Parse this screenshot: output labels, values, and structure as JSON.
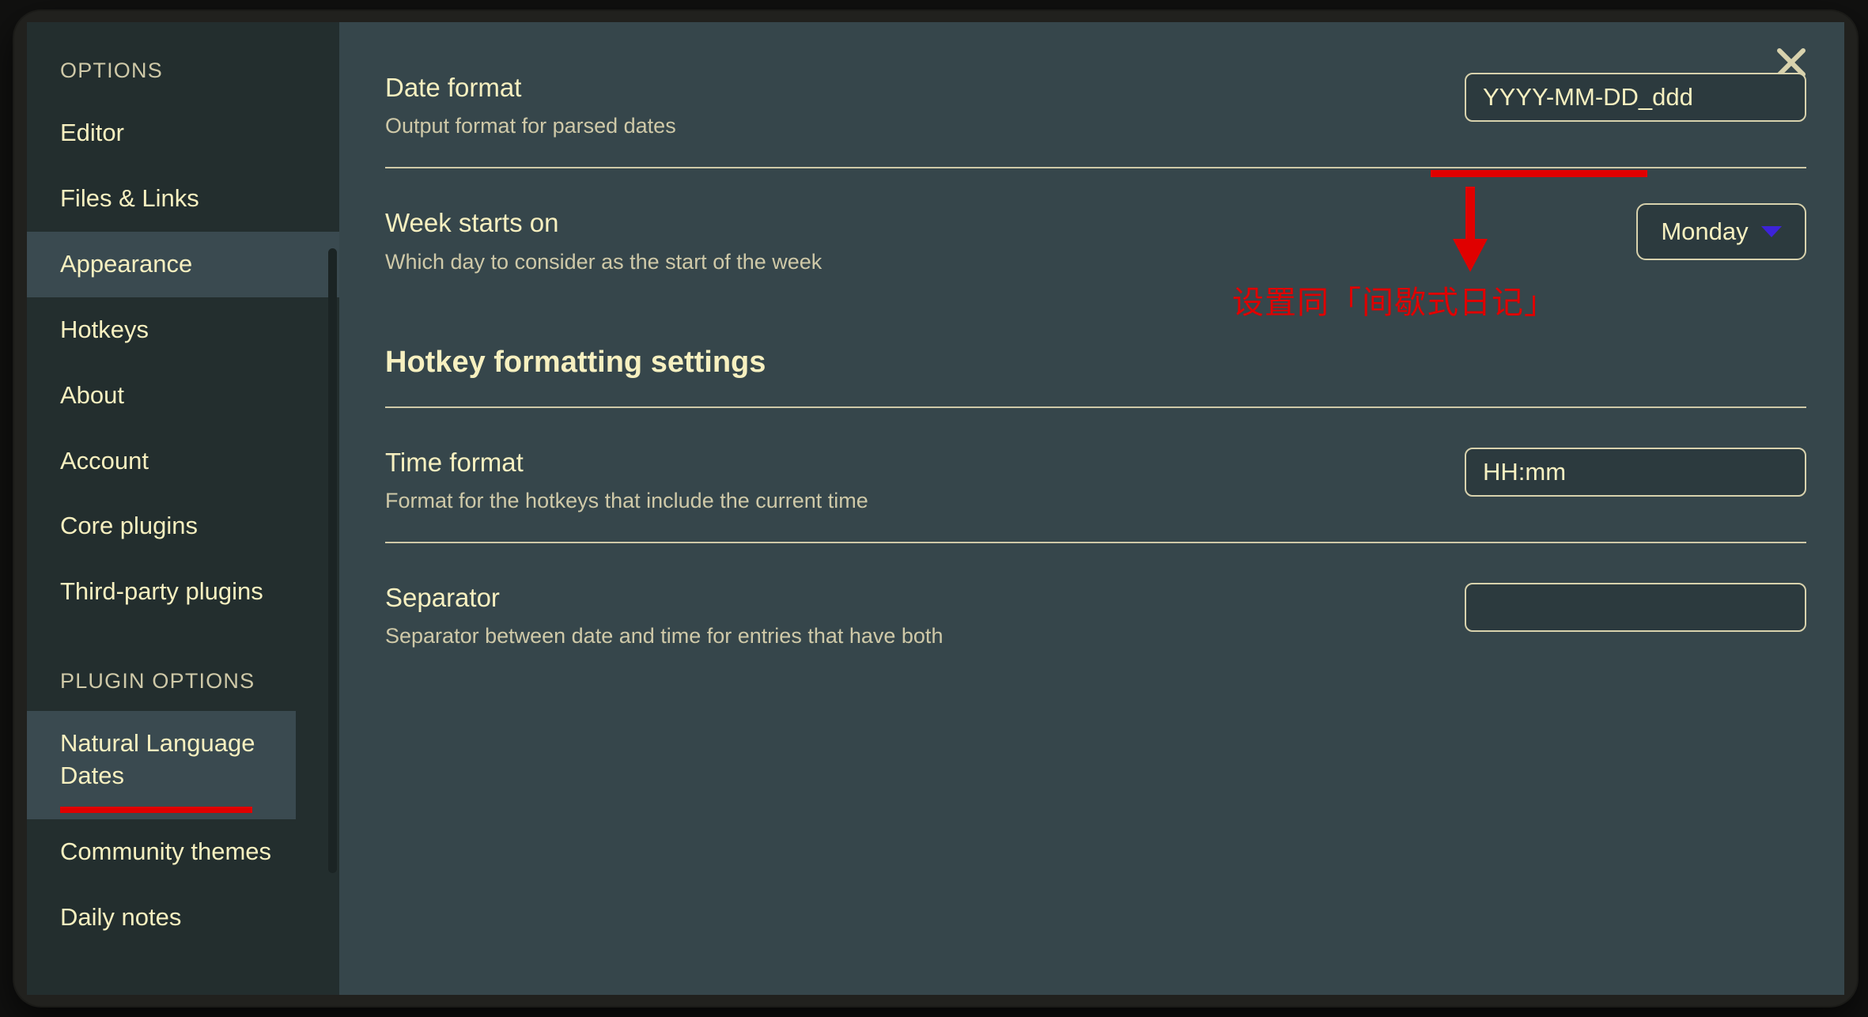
{
  "window": {
    "close_icon": "close-icon"
  },
  "sidebar": {
    "sections": [
      {
        "title": "OPTIONS",
        "items": [
          {
            "label": "Editor",
            "selected": false
          },
          {
            "label": "Files & Links",
            "selected": false
          },
          {
            "label": "Appearance",
            "selected": true
          },
          {
            "label": "Hotkeys",
            "selected": false
          },
          {
            "label": "About",
            "selected": false
          },
          {
            "label": "Account",
            "selected": false
          },
          {
            "label": "Core plugins",
            "selected": false
          },
          {
            "label": "Third-party plugins",
            "selected": false
          }
        ]
      },
      {
        "title": "PLUGIN OPTIONS",
        "items": [
          {
            "label": "Natural Language Dates",
            "selected": true,
            "annotated": true
          },
          {
            "label": "Community themes",
            "selected": false
          },
          {
            "label": "Daily notes",
            "selected": false
          }
        ]
      }
    ]
  },
  "main": {
    "settings": [
      {
        "name": "Date format",
        "desc": "Output format for parsed dates",
        "control": "text",
        "value": "YYYY-MM-DD_ddd",
        "placeholder": ""
      },
      {
        "name": "Week starts on",
        "desc": "Which day to consider as the start of the week",
        "control": "dropdown",
        "value": "Monday"
      }
    ],
    "section_heading": "Hotkey formatting settings",
    "hotkey_settings": [
      {
        "name": "Time format",
        "desc": "Format for the hotkeys that include the current time",
        "control": "text",
        "value": "HH:mm",
        "placeholder": ""
      },
      {
        "name": "Separator",
        "desc": "Separator between date and time for entries that have both",
        "control": "text",
        "value": "",
        "placeholder": ""
      }
    ]
  },
  "annotations": {
    "note_text": "设置同「间歇式日记」",
    "color": "#e00000"
  },
  "colors": {
    "modal_bg": "#36464b",
    "sidebar_bg": "#232e2e",
    "sidebar_selected_bg": "#3a4a50",
    "text_primary": "#f7f0c0",
    "text_secondary": "#cfc9a8",
    "accent_red": "#e00000",
    "caret_purple": "#3d23d8",
    "border": "#d8d2ad"
  }
}
